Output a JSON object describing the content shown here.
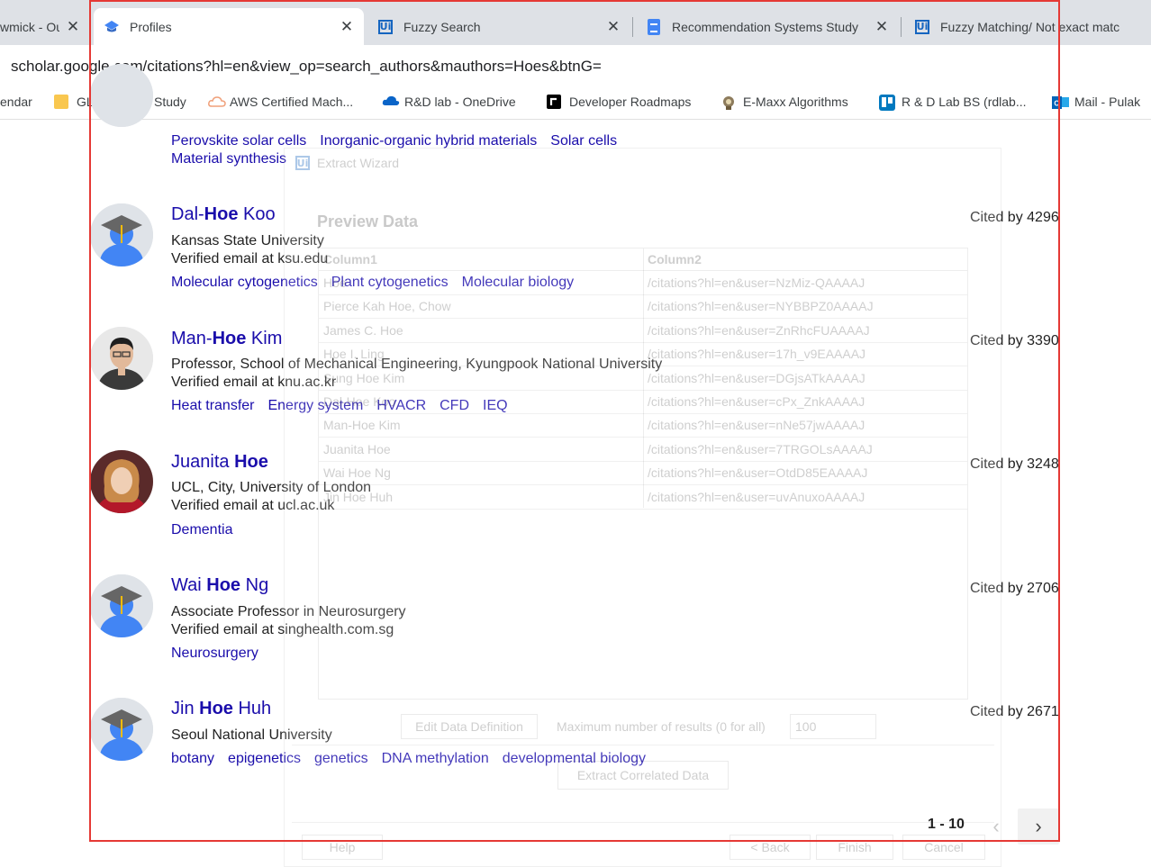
{
  "tabs": [
    {
      "title": "wmick - Ou",
      "icon": "none"
    },
    {
      "title": "Profiles",
      "icon": "scholar-cap-icon",
      "active": true
    },
    {
      "title": "Fuzzy Search",
      "icon": "uipath-icon"
    },
    {
      "title": "Recommendation Systems Study",
      "icon": "google-docs-icon"
    },
    {
      "title": "Fuzzy Matching/ Not exact matc",
      "icon": "uipath-icon"
    }
  ],
  "close_glyph": "✕",
  "address": {
    "url": "scholar.google.com/citations?hl=en&view_op=search_authors&mauthors=Hoes&btnG="
  },
  "bookmarks": [
    {
      "label": "endar"
    },
    {
      "label": "GLPG",
      "icon": "folder-icon"
    },
    {
      "label": "Study",
      "icon": "folder-icon"
    },
    {
      "label": "AWS Certified Mach...",
      "icon": "aws-cloud-icon"
    },
    {
      "label": "R&D lab - OneDrive",
      "icon": "onedrive-icon"
    },
    {
      "label": "Developer Roadmaps",
      "icon": "roadmap-icon"
    },
    {
      "label": "E-Maxx Algorithms",
      "icon": "emaxx-icon"
    },
    {
      "label": "R & D Lab BS (rdlab...",
      "icon": "trello-icon"
    },
    {
      "label": "Mail - Pulak",
      "icon": "outlook-icon"
    }
  ],
  "partial_profile": {
    "interests": [
      "Perovskite solar cells",
      "Inorganic-organic hybrid materials",
      "Solar cells",
      "Material synthesis"
    ]
  },
  "profiles": [
    {
      "name_pre": "Dal-",
      "name_hl": "Hoe",
      "name_post": " Koo",
      "affiliation": "Kansas State University",
      "email": "Verified email at ksu.edu",
      "interests": [
        "Molecular cytogenetics",
        "Plant cytogenetics",
        "Molecular biology"
      ],
      "cited": "Cited by 4296",
      "avatar": "default"
    },
    {
      "name_pre": "Man-",
      "name_hl": "Hoe",
      "name_post": " Kim",
      "affiliation": "Professor, School of Mechanical Engineering, Kyungpook National University",
      "email": "Verified email at knu.ac.kr",
      "interests": [
        "Heat transfer",
        "Energy system",
        "HVACR",
        "CFD",
        "IEQ"
      ],
      "cited": "Cited by 3390",
      "avatar": "photo-man"
    },
    {
      "name_pre": "Juanita ",
      "name_hl": "Hoe",
      "name_post": "",
      "affiliation": "UCL, City, University of London",
      "email": "Verified email at ucl.ac.uk",
      "interests": [
        "Dementia"
      ],
      "cited": "Cited by 3248",
      "avatar": "photo-woman"
    },
    {
      "name_pre": "Wai ",
      "name_hl": "Hoe",
      "name_post": " Ng",
      "affiliation": "Associate Professor in Neurosurgery",
      "email": "Verified email at singhealth.com.sg",
      "interests": [
        "Neurosurgery"
      ],
      "cited": "Cited by 2706",
      "avatar": "default"
    },
    {
      "name_pre": "Jin ",
      "name_hl": "Hoe",
      "name_post": " Huh",
      "affiliation": "Seoul National University",
      "email": "",
      "interests": [
        "botany",
        "epigenetics",
        "genetics",
        "DNA methylation",
        "developmental biology"
      ],
      "cited": "Cited by 2671",
      "avatar": "default"
    }
  ],
  "wizard": {
    "title": "Extract Wizard",
    "heading": "Preview Data",
    "columns": [
      "Column1",
      "Column2"
    ],
    "rows": [
      [
        "Hoe",
        "/citations?hl=en&user=NzMiz-QAAAAJ"
      ],
      [
        "Pierce Kah Hoe, Chow",
        "/citations?hl=en&user=NYBBPZ0AAAAJ"
      ],
      [
        "James C. Hoe",
        "/citations?hl=en&user=ZnRhcFUAAAAJ"
      ],
      [
        "Hoe I. Ling",
        "/citations?hl=en&user=17h_v9EAAAAJ"
      ],
      [
        "Sung Hoe Kim",
        "/citations?hl=en&user=DGjsATkAAAAJ"
      ],
      [
        "Dal-Hoe Koo",
        "/citations?hl=en&user=cPx_ZnkAAAAJ"
      ],
      [
        "Man-Hoe Kim",
        "/citations?hl=en&user=nNe57jwAAAAJ"
      ],
      [
        "Juanita Hoe",
        "/citations?hl=en&user=7TRGOLsAAAAJ"
      ],
      [
        "Wai Hoe Ng",
        "/citations?hl=en&user=OtdD85EAAAAJ"
      ],
      [
        "Jin Hoe Huh",
        "/citations?hl=en&user=uvAnuxoAAAAJ"
      ]
    ],
    "edit_button": "Edit Data Definition",
    "max_label": "Maximum number of results (0 for all)",
    "max_value": "100",
    "extract_button": "Extract Correlated Data",
    "help_button": "Help",
    "back_button": "< Back",
    "finish_button": "Finish",
    "cancel_button": "Cancel"
  },
  "pagination": {
    "range": "1 - 10",
    "prev": "‹",
    "next": "›"
  },
  "colors": {
    "link": "#1a0dab",
    "highlight_box": "#e53935"
  }
}
